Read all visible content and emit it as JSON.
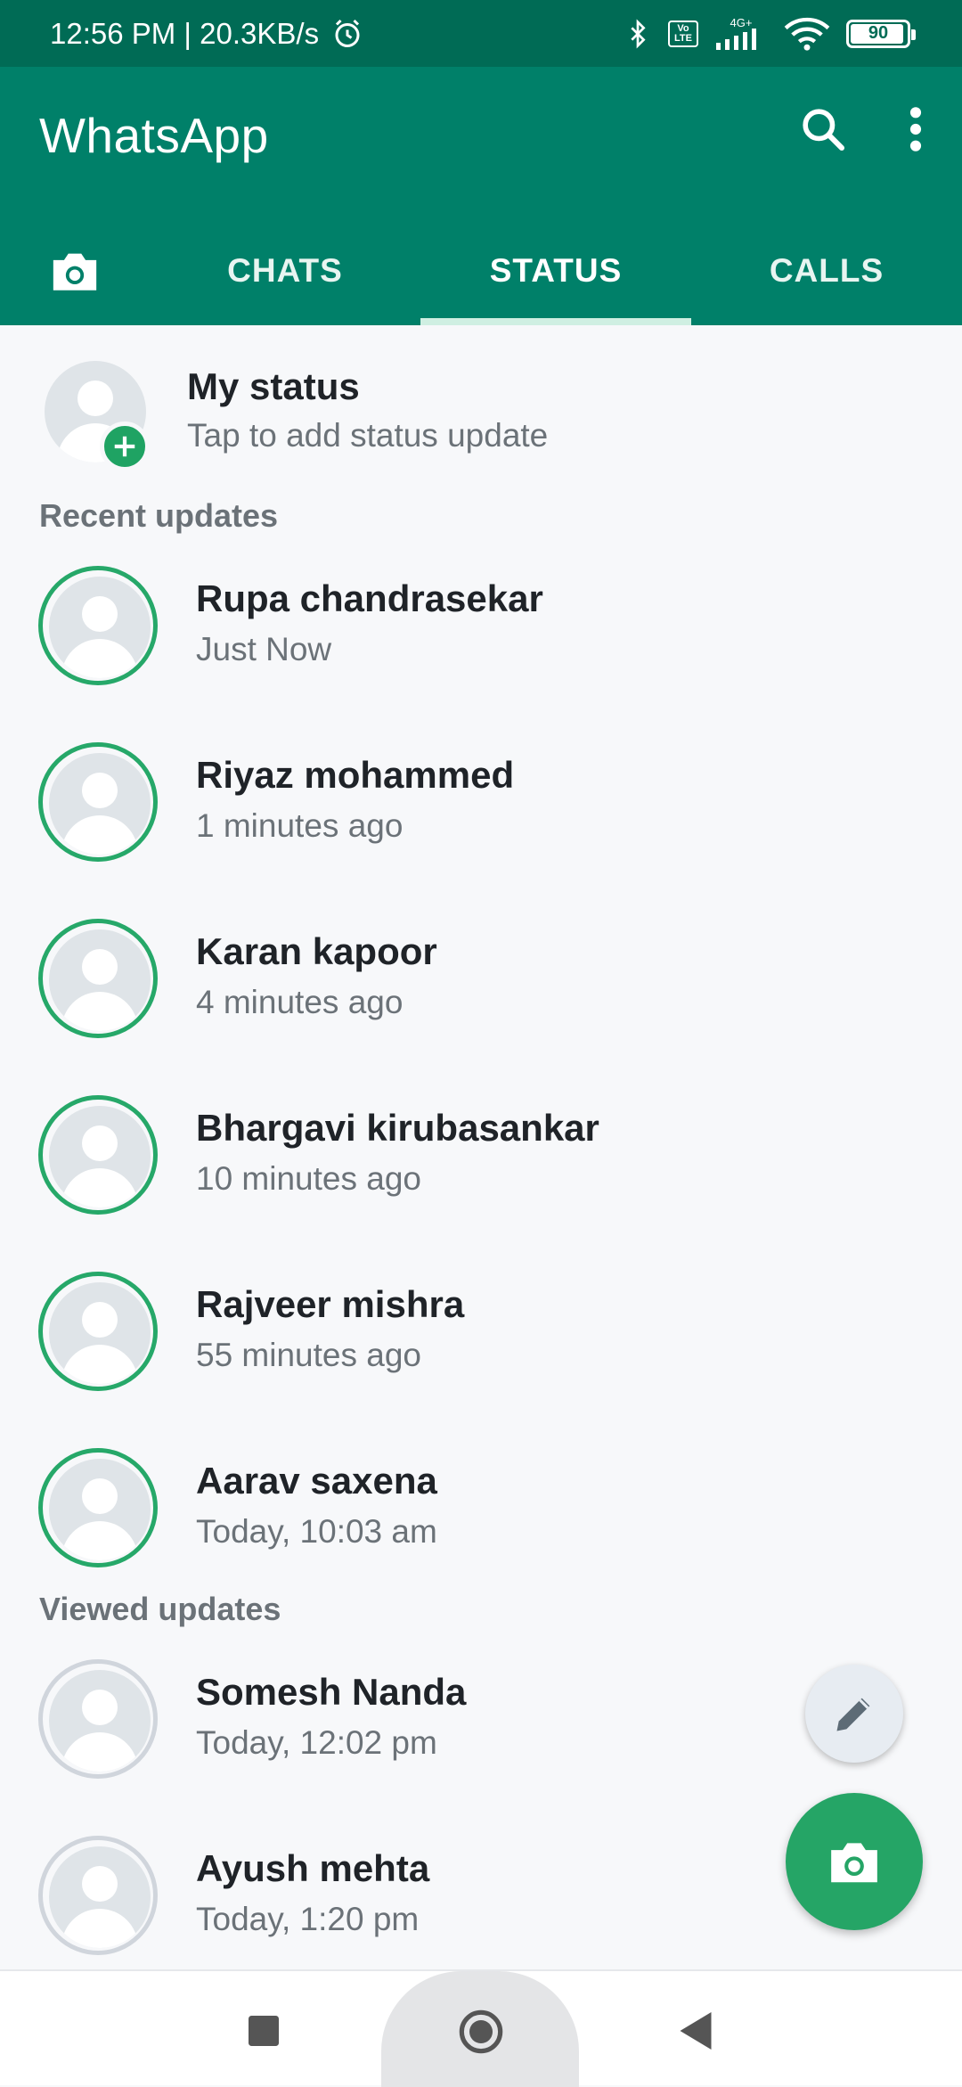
{
  "status_bar": {
    "time_speed": "12:56 PM | 20.3KB/s",
    "network_label": "4G+",
    "volte_label": "Vo LTE",
    "battery": "90"
  },
  "app": {
    "title": "WhatsApp",
    "tabs": [
      {
        "label": "CHATS"
      },
      {
        "label": "STATUS"
      },
      {
        "label": "CALLS"
      }
    ],
    "active_tab": "STATUS"
  },
  "my_status": {
    "title": "My status",
    "subtitle": "Tap to add status update"
  },
  "recent_updates": {
    "label": "Recent updates",
    "items": [
      {
        "name": "Rupa chandrasekar",
        "time": "Just Now"
      },
      {
        "name": "Riyaz mohammed",
        "time": "1 minutes ago"
      },
      {
        "name": "Karan kapoor",
        "time": "4 minutes ago"
      },
      {
        "name": "Bhargavi kirubasankar",
        "time": "10 minutes ago"
      },
      {
        "name": "Rajveer mishra",
        "time": "55 minutes ago"
      },
      {
        "name": "Aarav saxena",
        "time": "Today, 10:03 am"
      }
    ]
  },
  "viewed_updates": {
    "label": "Viewed updates",
    "items": [
      {
        "name": "Somesh Nanda",
        "time": "Today, 12:02 pm"
      },
      {
        "name": "Ayush mehta",
        "time": "Today, 1:20 pm"
      }
    ]
  },
  "colors": {
    "header": "#008069",
    "status_bar": "#006b55",
    "unseen_ring": "#26a869",
    "viewed_ring": "#d0d5dc",
    "fab": "#25a566"
  },
  "icons": {
    "camera_tab": "camera-icon",
    "search": "search-icon",
    "menu": "more-vert-icon",
    "edit_fab": "pencil-icon",
    "camera_fab": "camera-icon",
    "nav_recents": "square-icon",
    "nav_home": "circle-icon",
    "nav_back": "triangle-back-icon"
  }
}
